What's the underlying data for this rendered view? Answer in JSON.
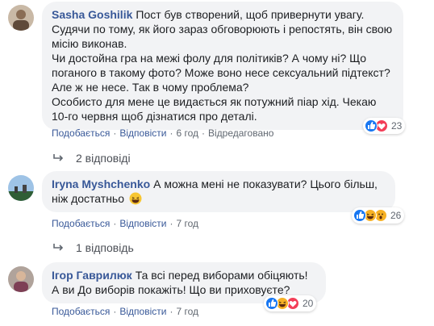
{
  "comments": [
    {
      "author": "Sasha Goshilik",
      "text": [
        "Пост був створений, щоб привернути увагу. Судячи по тому, як його зараз обговорюють і репостять, він свою місію виконав.",
        "Чи достойна гра на межі фолу для політиків? А чому ні? Що поганого в такому фото? Може воно несе сексуальний підтекст? Але ж не несе. Так в чому проблема?",
        "Особисто для мене це видається як потужний піар хід. Чекаю 10-го червня щоб дізнатися про деталі."
      ],
      "reactions": {
        "icons": [
          "like-icon",
          "love-icon"
        ],
        "count": "23"
      },
      "actions": {
        "like": "Подобається",
        "reply": "Відповісти",
        "time": "6 год",
        "edited": "Відредаговано"
      },
      "replies": "2 відповіді"
    },
    {
      "author": "Iryna Myshchenko",
      "text_line1": "А можна мені не показувати? Цього більш,",
      "text_line2": "ніж достатньо",
      "reactions": {
        "icons": [
          "like-icon",
          "haha-icon",
          "wow-icon"
        ],
        "count": "26"
      },
      "actions": {
        "like": "Подобається",
        "reply": "Відповісти",
        "time": "7 год"
      },
      "replies": "1 відповідь"
    },
    {
      "author": "Ігор Гаврилюк",
      "text_line1": "Та всі перед виборами обіцяють!",
      "text_line2": "А ви До виборів покажіть! Що ви приховуєте?",
      "reactions": {
        "icons": [
          "like-icon",
          "haha-icon",
          "love-icon"
        ],
        "count": "20"
      },
      "actions": {
        "like": "Подобається",
        "reply": "Відповісти",
        "time": "7 год"
      }
    }
  ],
  "colors": {
    "bubble": "#f2f3f5",
    "link": "#385898",
    "meta": "#606770",
    "like": "#1877f2",
    "love": "#f33e58",
    "haha": "#f7b125"
  }
}
